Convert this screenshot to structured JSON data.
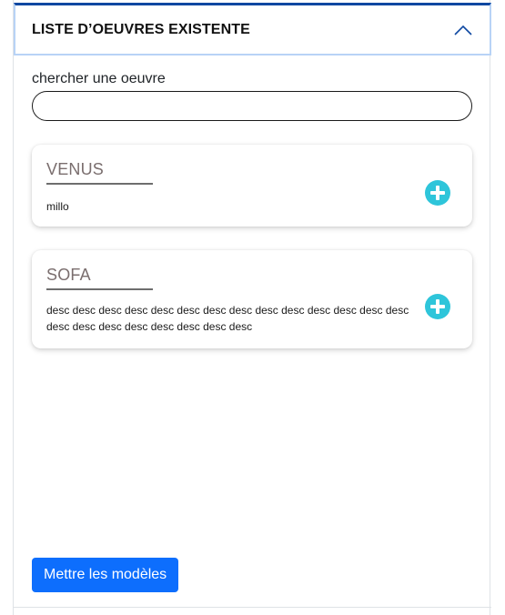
{
  "accordion": {
    "title": "LISTE D’OEUVRES EXISTENTE",
    "toggle_icon": "chevron-up-icon",
    "expanded": true
  },
  "search": {
    "label": "chercher une oeuvre",
    "value": "",
    "placeholder": ""
  },
  "works": [
    {
      "title": "VENUS",
      "description": "millo",
      "action_icon": "plus-circle-icon"
    },
    {
      "title": "SOFA",
      "description": "desc desc desc desc desc desc desc desc desc desc desc desc desc desc desc desc desc desc desc desc desc desc",
      "action_icon": "plus-circle-icon"
    }
  ],
  "footer": {
    "submit_label": "Mettre les modèles"
  },
  "colors": {
    "accent": "#0d6efd",
    "header_border_top": "#0d47a1",
    "header_border": "#b8d3f6",
    "add_icon": "#2ec5da",
    "card_title": "#7a6e6e"
  }
}
